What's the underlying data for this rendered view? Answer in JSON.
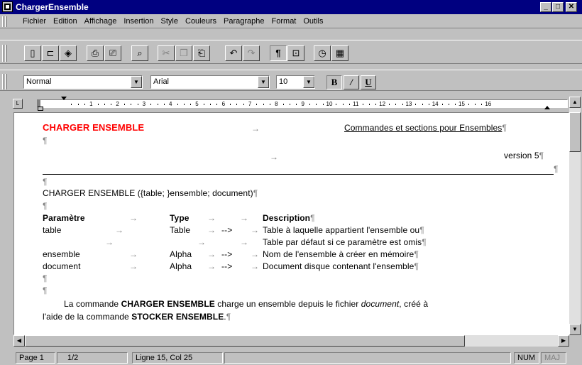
{
  "window": {
    "title": "ChargerEnsemble"
  },
  "menu": [
    "Fichier",
    "Edition",
    "Affichage",
    "Insertion",
    "Style",
    "Couleurs",
    "Paragraphe",
    "Format",
    "Outils"
  ],
  "toolbar": {
    "style_value": "Normal",
    "font_value": "Arial",
    "size_value": "10",
    "bold_label": "B",
    "italic_label": "/",
    "underline_label": "U"
  },
  "ruler": {
    "numbers": [
      "1",
      "2",
      "3",
      "4",
      "5",
      "6",
      "7",
      "8",
      "9",
      "10",
      "11",
      "12",
      "13",
      "14",
      "15",
      "16"
    ]
  },
  "document": {
    "heading": "CHARGER ENSEMBLE",
    "heading_right": "Commandes et sections pour Ensembles",
    "version": "version 5",
    "syntax": "CHARGER ENSEMBLE ({table; }ensemble; document)",
    "col_param": "Paramètre",
    "col_type": "Type",
    "col_desc": "Description",
    "rows": [
      {
        "param": "table",
        "type": "Table",
        "arrow": "-->",
        "desc": "Table à laquelle appartient l'ensemble ou"
      },
      {
        "param": "",
        "type": "",
        "arrow": "",
        "desc": "Table par défaut si ce paramètre est omis"
      },
      {
        "param": "ensemble",
        "type": "Alpha",
        "arrow": "-->",
        "desc": "Nom de l'ensemble à créer en mémoire"
      },
      {
        "param": "document",
        "type": "Alpha",
        "arrow": "-->",
        "desc": "Document disque contenant l'ensemble"
      }
    ],
    "body_1": "La commande ",
    "body_2": "CHARGER ENSEMBLE",
    "body_3": " charge un ensemble depuis le fichier ",
    "body_4": "document",
    "body_5": ", créé à",
    "body_6": "l'aide de la commande ",
    "body_7": "STOCKER ENSEMBLE",
    "body_8": "."
  },
  "status": {
    "page": "Page 1",
    "pages": "1/2",
    "position": "Ligne 15, Col 25",
    "num": "NUM",
    "maj": "MAJ"
  }
}
